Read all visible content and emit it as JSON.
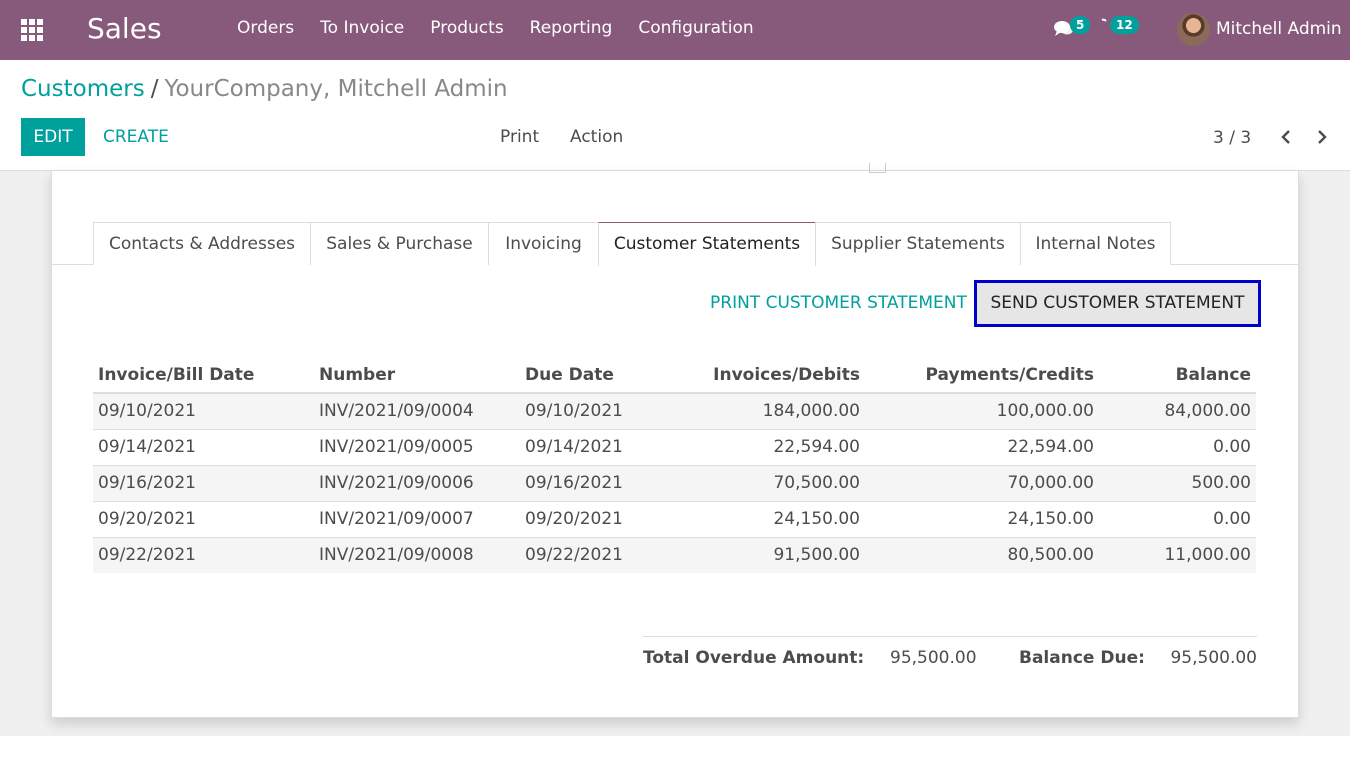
{
  "topbar": {
    "app_name": "Sales",
    "menu": [
      "Orders",
      "To Invoice",
      "Products",
      "Reporting",
      "Configuration"
    ],
    "messages_count": "5",
    "activities_count": "12",
    "user_name": "Mitchell Admin",
    "bg_color": "#875a7b"
  },
  "breadcrumb": {
    "parent": "Customers",
    "separator": "/",
    "current": "YourCompany, Mitchell Admin"
  },
  "toolbar": {
    "edit_label": "EDIT",
    "create_label": "CREATE",
    "print_label": "Print",
    "action_label": "Action",
    "pager": "3 / 3"
  },
  "tabs": [
    "Contacts & Addresses",
    "Sales & Purchase",
    "Invoicing",
    "Customer Statements",
    "Supplier Statements",
    "Internal Notes"
  ],
  "active_tab": "Customer Statements",
  "statement": {
    "print_label": "PRINT CUSTOMER STATEMENT",
    "send_label": "SEND CUSTOMER STATEMENT",
    "columns": [
      "Invoice/Bill Date",
      "Number",
      "Due Date",
      "Invoices/Debits",
      "Payments/Credits",
      "Balance"
    ],
    "rows": [
      [
        "09/10/2021",
        "INV/2021/09/0004",
        "09/10/2021",
        "184,000.00",
        "100,000.00",
        "84,000.00"
      ],
      [
        "09/14/2021",
        "INV/2021/09/0005",
        "09/14/2021",
        "22,594.00",
        "22,594.00",
        "0.00"
      ],
      [
        "09/16/2021",
        "INV/2021/09/0006",
        "09/16/2021",
        "70,500.00",
        "70,000.00",
        "500.00"
      ],
      [
        "09/20/2021",
        "INV/2021/09/0007",
        "09/20/2021",
        "24,150.00",
        "24,150.00",
        "0.00"
      ],
      [
        "09/22/2021",
        "INV/2021/09/0008",
        "09/22/2021",
        "91,500.00",
        "80,500.00",
        "11,000.00"
      ]
    ],
    "overdue_label": "Total Overdue Amount:",
    "overdue_value": "95,500.00",
    "balance_label": "Balance Due:",
    "balance_value": "95,500.00"
  },
  "colors": {
    "accent": "#00a09d",
    "highlight_border": "#0000cc"
  }
}
